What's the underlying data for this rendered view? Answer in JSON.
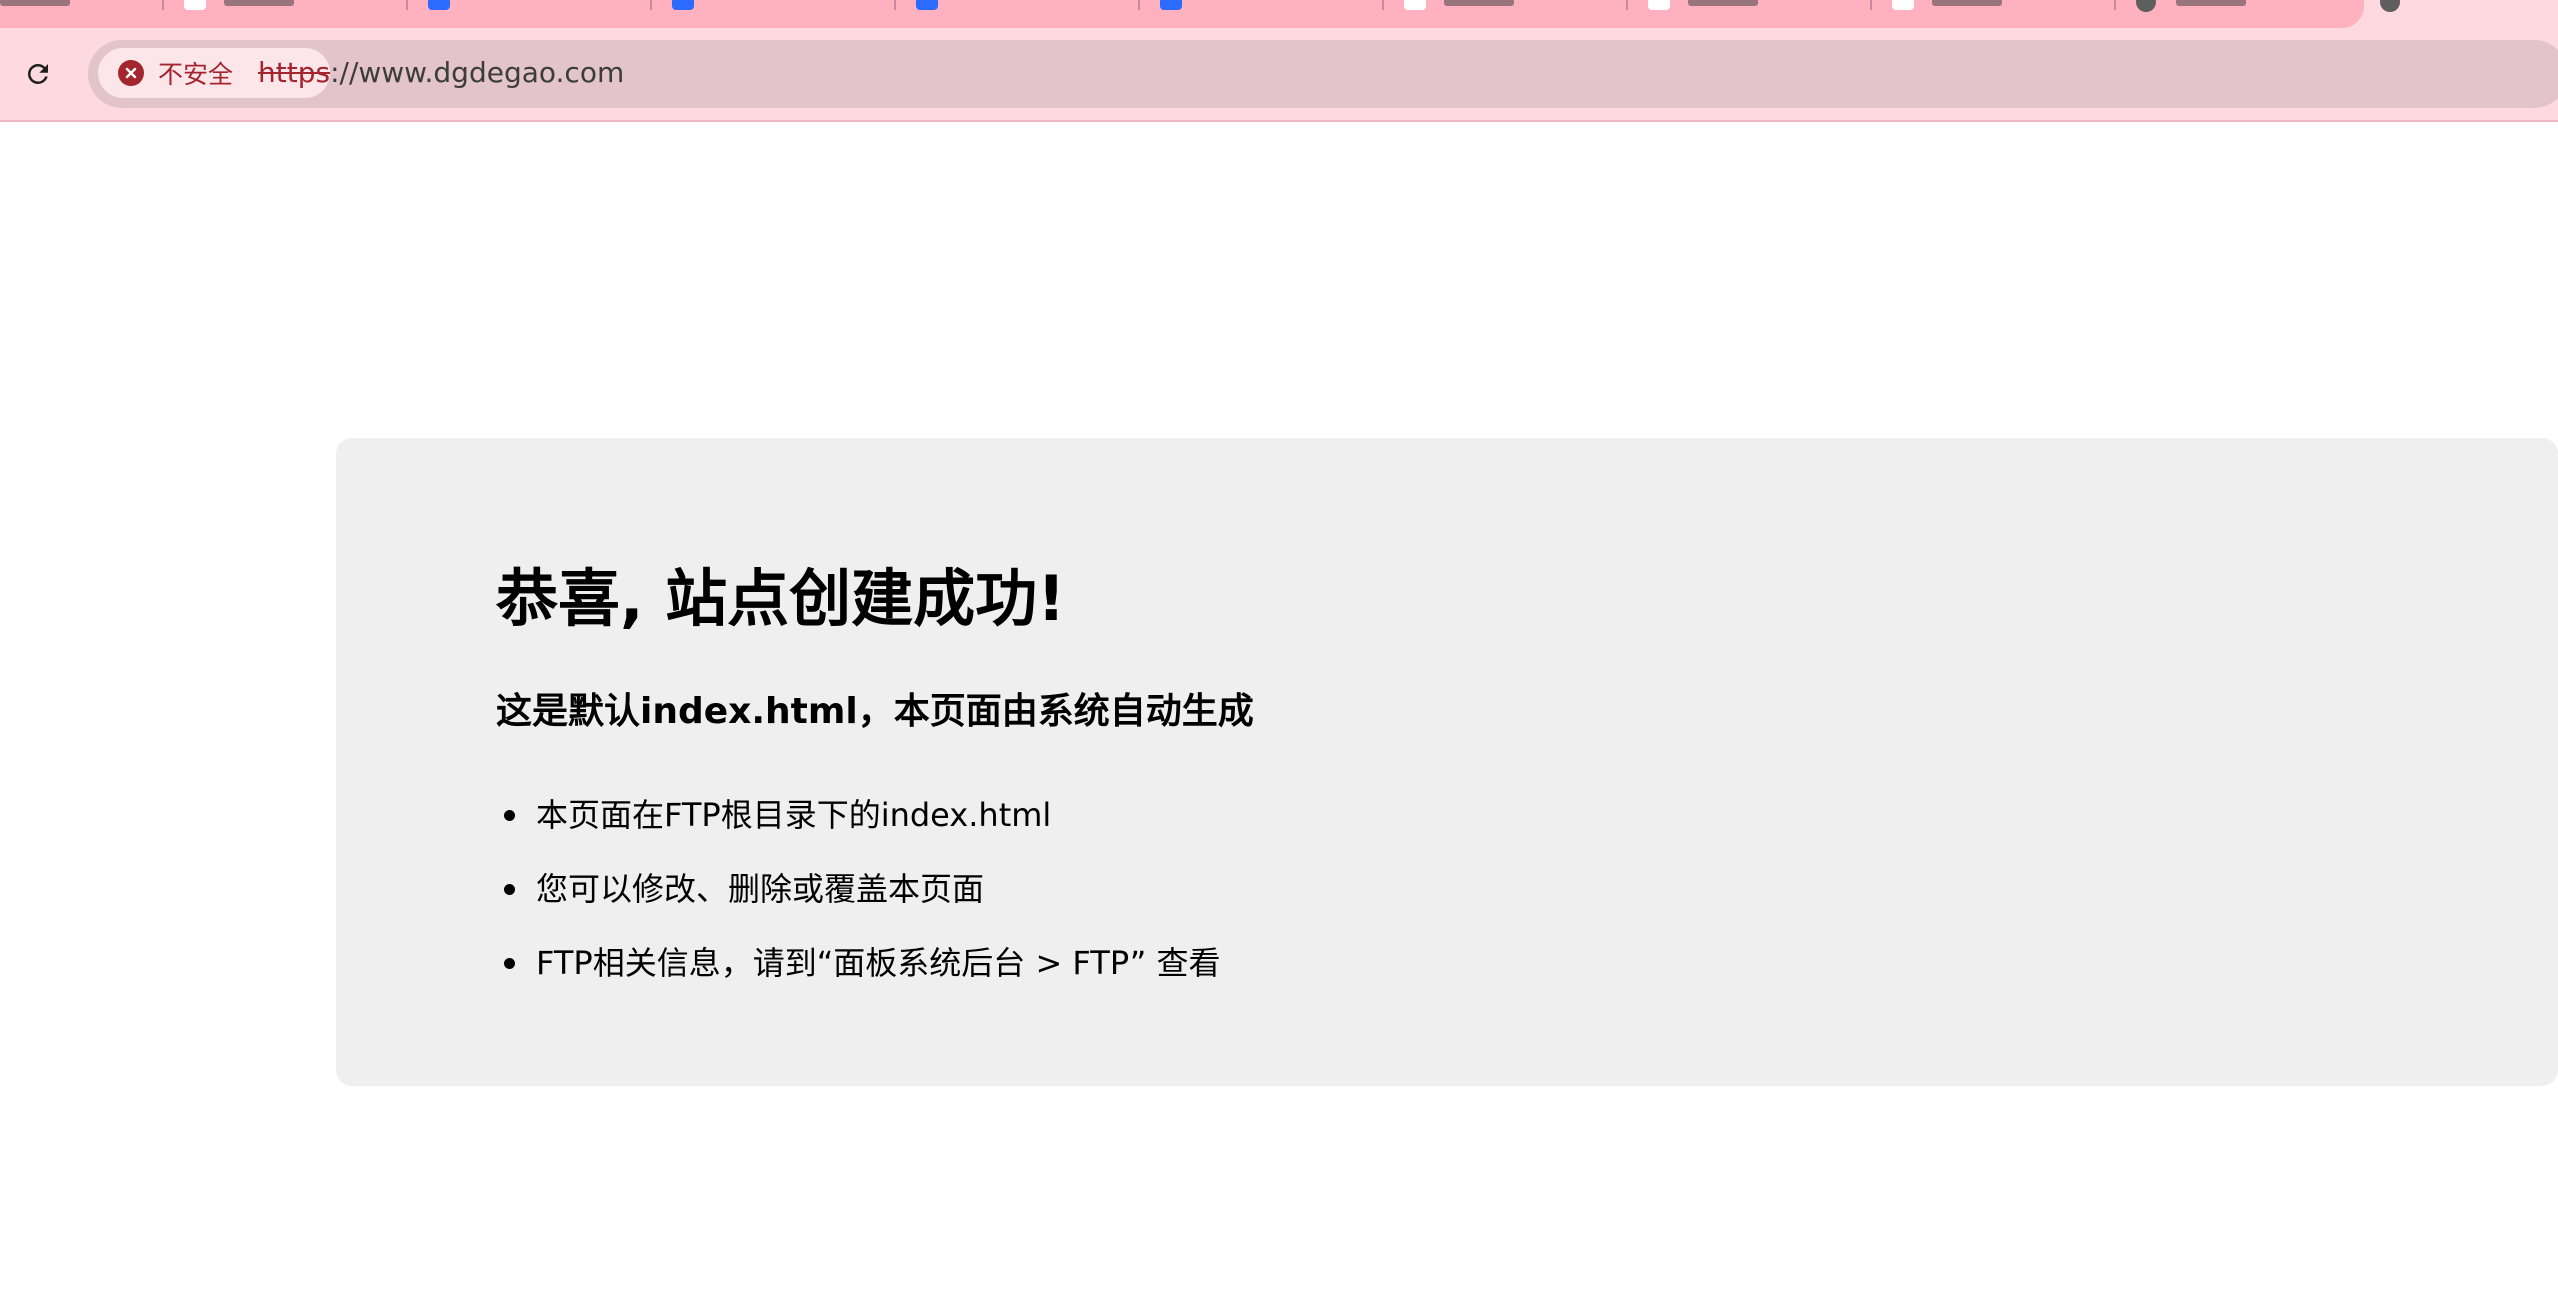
{
  "browser": {
    "reload_icon": "reload-icon",
    "security": {
      "icon": "close-circle-icon",
      "label": "不安全",
      "color": "#a3252e"
    },
    "url": {
      "scheme": "https",
      "rest": "://www.dgdegao.com"
    },
    "accent": "#ffb1c0"
  },
  "page": {
    "title": "恭喜, 站点创建成功!",
    "subtitle": "这是默认index.html，本页面由系统自动生成",
    "items": [
      {
        "text": "本页面在FTP根目录下的index.html"
      },
      {
        "text": "您可以修改、删除或覆盖本页面"
      },
      {
        "text": "FTP相关信息，请到“面板系统后台 > FTP” 查看"
      }
    ]
  }
}
